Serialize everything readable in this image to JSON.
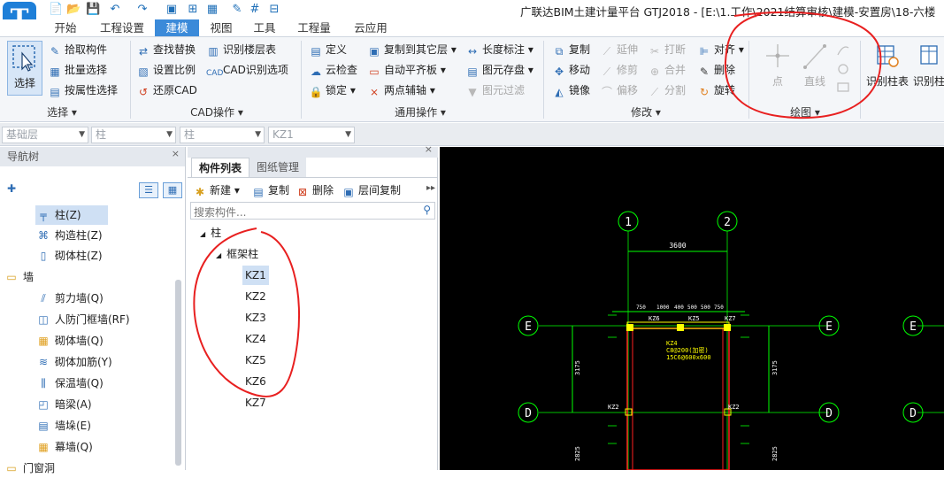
{
  "app": {
    "logo_letter": "T",
    "title": "广联达BIM土建计量平台 GTJ2018 - [E:\\1.工作\\2021结算审核\\建模-安置房\\18-六楼"
  },
  "quick_access": [
    "📄",
    "📂",
    "💾",
    "↶",
    "↷",
    "▣",
    "⊞",
    "▦",
    "✎",
    "#",
    "⊟"
  ],
  "menu": {
    "tabs": [
      "开始",
      "工程设置",
      "建模",
      "视图",
      "工具",
      "工程量",
      "云应用"
    ],
    "active": "建模"
  },
  "ribbon": {
    "select": {
      "big_button": "选择",
      "items": [
        "拾取构件",
        "批量选择",
        "按属性选择"
      ],
      "label": "选择"
    },
    "cad": {
      "items": [
        "查找替换",
        "设置比例",
        "还原CAD",
        "识别楼层表",
        "CAD识别选项"
      ],
      "label": "CAD操作"
    },
    "common": {
      "items": [
        "定义",
        "云检查",
        "锁定",
        "复制到其它层",
        "自动平齐板",
        "两点辅轴",
        "长度标注",
        "图元存盘",
        "图元过滤"
      ],
      "label": "通用操作"
    },
    "modify": {
      "items": [
        "复制",
        "移动",
        "镜像",
        "延伸",
        "修剪",
        "偏移",
        "打断",
        "合并",
        "分割",
        "对齐",
        "删除",
        "旋转"
      ],
      "label": "修改"
    },
    "draw": {
      "items": [
        "点",
        "直线"
      ],
      "label": "绘图"
    },
    "recognize": {
      "items": [
        "识别柱表",
        "识别柱"
      ]
    }
  },
  "selectors": {
    "floor": "基础层",
    "category": "柱",
    "type": "柱",
    "component": "KZ1"
  },
  "nav": {
    "title": "导航树",
    "items": [
      "柱(Z)",
      "构造柱(Z)",
      "砌体柱(Z)",
      "墙",
      "剪力墙(Q)",
      "人防门框墙(RF)",
      "砌体墙(Q)",
      "砌体加筋(Y)",
      "保温墙(Q)",
      "暗梁(A)",
      "墙垛(E)",
      "幕墙(Q)",
      "门窗洞"
    ],
    "selected": "柱(Z)"
  },
  "component_panel": {
    "tabs": [
      "构件列表",
      "图纸管理"
    ],
    "toolbar": [
      "新建",
      "复制",
      "删除",
      "层间复制"
    ],
    "search_placeholder": "搜索构件...",
    "root": "柱",
    "group": "框架柱",
    "items": [
      "KZ1",
      "KZ2",
      "KZ3",
      "KZ4",
      "KZ5",
      "KZ6",
      "KZ7"
    ],
    "selected": "KZ1"
  },
  "cad": {
    "axis_top": [
      "1",
      "2"
    ],
    "axis_side": [
      "E",
      "D"
    ],
    "dim_span": "3600",
    "dim_left": "3175",
    "dim_right": "3175",
    "dim_bottom_left": "2825",
    "dim_bottom_right": "2825",
    "col_labels": [
      "KZ6",
      "KZ5",
      "KZ7",
      "KZ2",
      "KZ2"
    ],
    "sub_dims": [
      "750",
      "1000",
      "400",
      "500",
      "500",
      "750"
    ],
    "note_lines": [
      "KZ4",
      "C8@200(加密)",
      "15C6@600x600"
    ],
    "colors": {
      "axis": "#00ff00",
      "beam": "#ff2020",
      "text": "#ffff00",
      "col": "#ffff00",
      "dim": "#00ff00"
    }
  }
}
